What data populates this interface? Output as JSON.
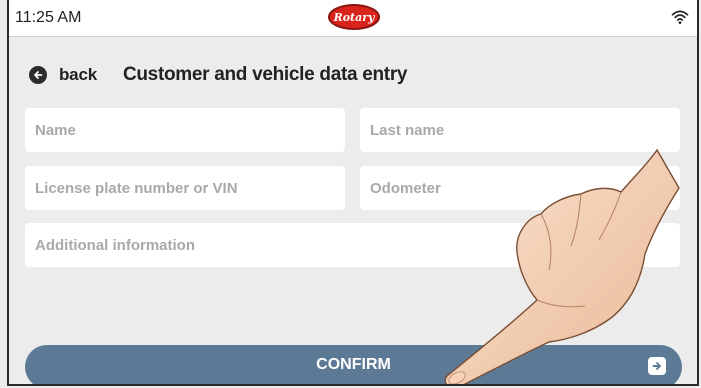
{
  "status_bar": {
    "time": "11:25 AM",
    "logo_text": "Rotary",
    "wifi_icon": "wifi-icon"
  },
  "header": {
    "back_label": "back",
    "back_icon": "arrow-left-circle-icon",
    "title": "Customer and vehicle data entry"
  },
  "form": {
    "name_placeholder": "Name",
    "last_name_placeholder": "Last name",
    "plate_placeholder": "License plate number or VIN",
    "odometer_placeholder": "Odometer",
    "additional_placeholder": "Additional information"
  },
  "confirm": {
    "label": "CONFIRM",
    "icon": "arrow-right-square-icon"
  },
  "colors": {
    "background": "#ececec",
    "field": "#ffffff",
    "placeholder": "#a9a9a9",
    "confirm_button": "#5c7a95",
    "logo_red": "#d9241c"
  }
}
